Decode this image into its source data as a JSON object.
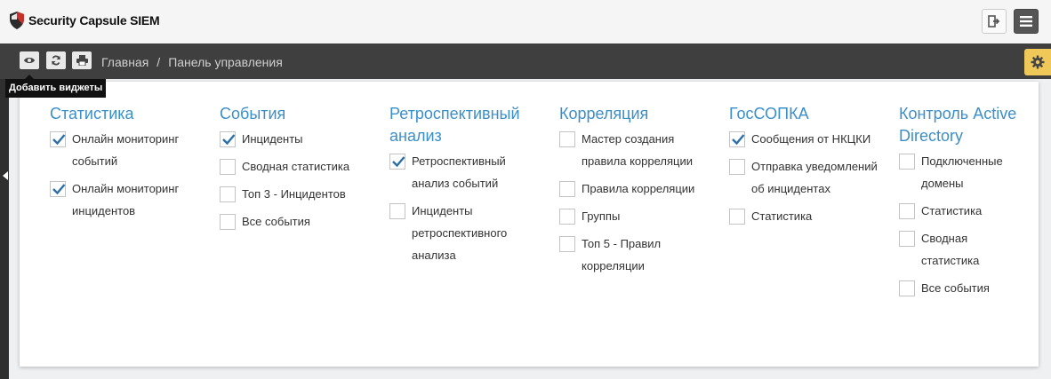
{
  "header": {
    "app_title": "Security Capsule SIEM"
  },
  "toolbar": {
    "breadcrumb": [
      "Главная",
      "Панель управления"
    ],
    "tooltip": "Добавить виджеты"
  },
  "widgets": {
    "columns": [
      {
        "title": "Статистика",
        "items": [
          {
            "label": "Онлайн мониторинг событий",
            "checked": true
          },
          {
            "label": "Онлайн мониторинг инцидентов",
            "checked": true
          }
        ]
      },
      {
        "title": "События",
        "items": [
          {
            "label": "Инциденты",
            "checked": true
          },
          {
            "label": "Сводная статистика",
            "checked": false
          },
          {
            "label": "Топ 3 - Инцидентов",
            "checked": false
          },
          {
            "label": "Все события",
            "checked": false
          }
        ]
      },
      {
        "title": "Ретроспективный анализ",
        "items": [
          {
            "label": "Ретроспективный анализ событий",
            "checked": true
          },
          {
            "label": "Инциденты ретроспективного анализа",
            "checked": false
          }
        ]
      },
      {
        "title": "Корреляция",
        "items": [
          {
            "label": "Мастер создания правила корреляции",
            "checked": false
          },
          {
            "label": "Правила корреляции",
            "checked": false
          },
          {
            "label": "Группы",
            "checked": false
          },
          {
            "label": "Топ 5 - Правил корреляции",
            "checked": false
          }
        ]
      },
      {
        "title": "ГосСОПКА",
        "items": [
          {
            "label": "Сообщения от НКЦКИ",
            "checked": true
          },
          {
            "label": "Отправка уведомлений об инцидентах",
            "checked": false
          },
          {
            "label": "Статистика",
            "checked": false
          }
        ]
      },
      {
        "title": "Контроль Active Directory",
        "items": [
          {
            "label": "Подключенные домены",
            "checked": false
          },
          {
            "label": "Статистика",
            "checked": false
          },
          {
            "label": "Сводная статистика",
            "checked": false
          },
          {
            "label": "Все события",
            "checked": false
          }
        ]
      }
    ]
  },
  "colors": {
    "accent": "#3b8fc9",
    "check": "#2a6fa8",
    "toolbar_bg": "#3f3f3f",
    "gear_bg": "#f0c85a"
  }
}
